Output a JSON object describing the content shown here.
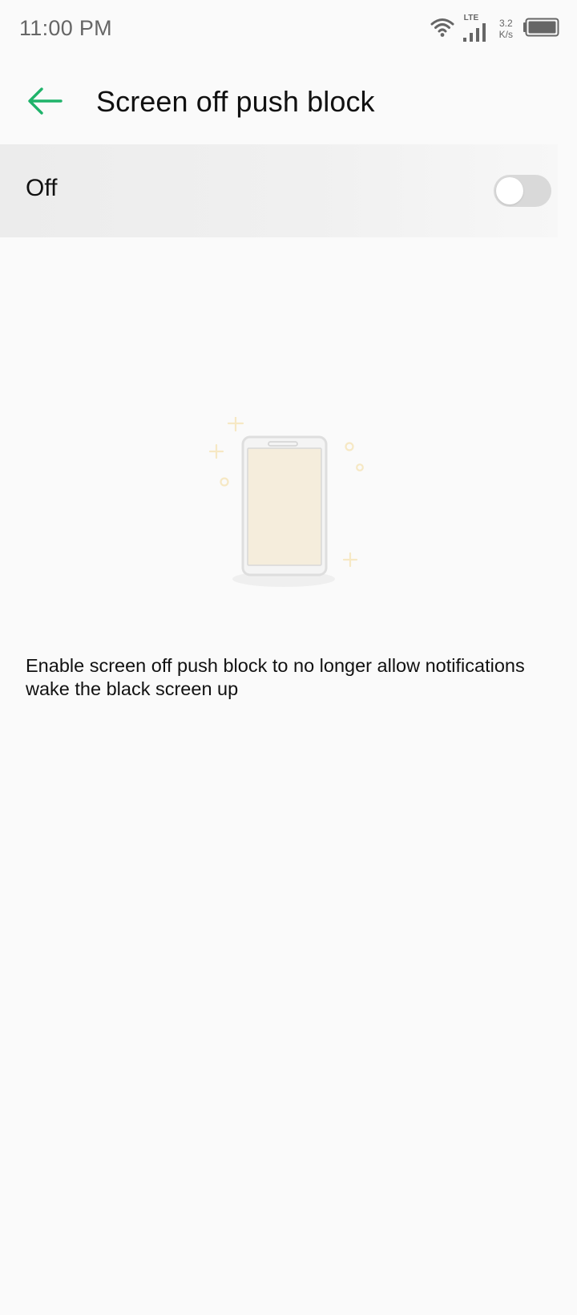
{
  "status_bar": {
    "time": "11:00 PM",
    "network_type": "LTE",
    "speed_value": "3.2",
    "speed_unit": "K/s",
    "icons": [
      "wifi-icon",
      "signal-icon",
      "battery-icon"
    ]
  },
  "header": {
    "title": "Screen off push block",
    "back_icon": "arrow-left-icon",
    "accent_color": "#1fb36a"
  },
  "toggle": {
    "label": "Off",
    "state": false
  },
  "illustration": {
    "icon": "phone-illustration"
  },
  "description": "Enable screen off push block to no longer allow notifications wake the black screen up"
}
